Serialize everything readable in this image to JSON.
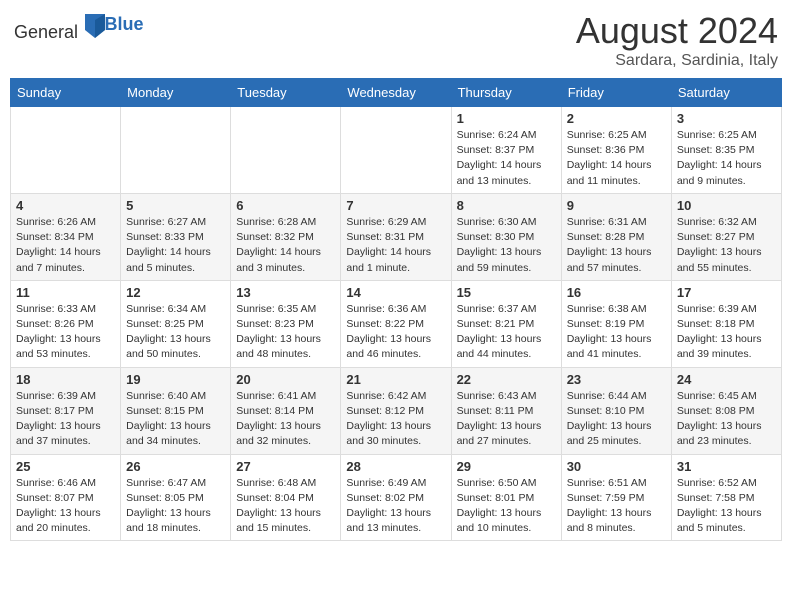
{
  "header": {
    "logo_general": "General",
    "logo_blue": "Blue",
    "month_year": "August 2024",
    "location": "Sardara, Sardinia, Italy"
  },
  "weekdays": [
    "Sunday",
    "Monday",
    "Tuesday",
    "Wednesday",
    "Thursday",
    "Friday",
    "Saturday"
  ],
  "weeks": [
    [
      {
        "day": "",
        "info": ""
      },
      {
        "day": "",
        "info": ""
      },
      {
        "day": "",
        "info": ""
      },
      {
        "day": "",
        "info": ""
      },
      {
        "day": "1",
        "info": "Sunrise: 6:24 AM\nSunset: 8:37 PM\nDaylight: 14 hours and 13 minutes."
      },
      {
        "day": "2",
        "info": "Sunrise: 6:25 AM\nSunset: 8:36 PM\nDaylight: 14 hours and 11 minutes."
      },
      {
        "day": "3",
        "info": "Sunrise: 6:25 AM\nSunset: 8:35 PM\nDaylight: 14 hours and 9 minutes."
      }
    ],
    [
      {
        "day": "4",
        "info": "Sunrise: 6:26 AM\nSunset: 8:34 PM\nDaylight: 14 hours and 7 minutes."
      },
      {
        "day": "5",
        "info": "Sunrise: 6:27 AM\nSunset: 8:33 PM\nDaylight: 14 hours and 5 minutes."
      },
      {
        "day": "6",
        "info": "Sunrise: 6:28 AM\nSunset: 8:32 PM\nDaylight: 14 hours and 3 minutes."
      },
      {
        "day": "7",
        "info": "Sunrise: 6:29 AM\nSunset: 8:31 PM\nDaylight: 14 hours and 1 minute."
      },
      {
        "day": "8",
        "info": "Sunrise: 6:30 AM\nSunset: 8:30 PM\nDaylight: 13 hours and 59 minutes."
      },
      {
        "day": "9",
        "info": "Sunrise: 6:31 AM\nSunset: 8:28 PM\nDaylight: 13 hours and 57 minutes."
      },
      {
        "day": "10",
        "info": "Sunrise: 6:32 AM\nSunset: 8:27 PM\nDaylight: 13 hours and 55 minutes."
      }
    ],
    [
      {
        "day": "11",
        "info": "Sunrise: 6:33 AM\nSunset: 8:26 PM\nDaylight: 13 hours and 53 minutes."
      },
      {
        "day": "12",
        "info": "Sunrise: 6:34 AM\nSunset: 8:25 PM\nDaylight: 13 hours and 50 minutes."
      },
      {
        "day": "13",
        "info": "Sunrise: 6:35 AM\nSunset: 8:23 PM\nDaylight: 13 hours and 48 minutes."
      },
      {
        "day": "14",
        "info": "Sunrise: 6:36 AM\nSunset: 8:22 PM\nDaylight: 13 hours and 46 minutes."
      },
      {
        "day": "15",
        "info": "Sunrise: 6:37 AM\nSunset: 8:21 PM\nDaylight: 13 hours and 44 minutes."
      },
      {
        "day": "16",
        "info": "Sunrise: 6:38 AM\nSunset: 8:19 PM\nDaylight: 13 hours and 41 minutes."
      },
      {
        "day": "17",
        "info": "Sunrise: 6:39 AM\nSunset: 8:18 PM\nDaylight: 13 hours and 39 minutes."
      }
    ],
    [
      {
        "day": "18",
        "info": "Sunrise: 6:39 AM\nSunset: 8:17 PM\nDaylight: 13 hours and 37 minutes."
      },
      {
        "day": "19",
        "info": "Sunrise: 6:40 AM\nSunset: 8:15 PM\nDaylight: 13 hours and 34 minutes."
      },
      {
        "day": "20",
        "info": "Sunrise: 6:41 AM\nSunset: 8:14 PM\nDaylight: 13 hours and 32 minutes."
      },
      {
        "day": "21",
        "info": "Sunrise: 6:42 AM\nSunset: 8:12 PM\nDaylight: 13 hours and 30 minutes."
      },
      {
        "day": "22",
        "info": "Sunrise: 6:43 AM\nSunset: 8:11 PM\nDaylight: 13 hours and 27 minutes."
      },
      {
        "day": "23",
        "info": "Sunrise: 6:44 AM\nSunset: 8:10 PM\nDaylight: 13 hours and 25 minutes."
      },
      {
        "day": "24",
        "info": "Sunrise: 6:45 AM\nSunset: 8:08 PM\nDaylight: 13 hours and 23 minutes."
      }
    ],
    [
      {
        "day": "25",
        "info": "Sunrise: 6:46 AM\nSunset: 8:07 PM\nDaylight: 13 hours and 20 minutes."
      },
      {
        "day": "26",
        "info": "Sunrise: 6:47 AM\nSunset: 8:05 PM\nDaylight: 13 hours and 18 minutes."
      },
      {
        "day": "27",
        "info": "Sunrise: 6:48 AM\nSunset: 8:04 PM\nDaylight: 13 hours and 15 minutes."
      },
      {
        "day": "28",
        "info": "Sunrise: 6:49 AM\nSunset: 8:02 PM\nDaylight: 13 hours and 13 minutes."
      },
      {
        "day": "29",
        "info": "Sunrise: 6:50 AM\nSunset: 8:01 PM\nDaylight: 13 hours and 10 minutes."
      },
      {
        "day": "30",
        "info": "Sunrise: 6:51 AM\nSunset: 7:59 PM\nDaylight: 13 hours and 8 minutes."
      },
      {
        "day": "31",
        "info": "Sunrise: 6:52 AM\nSunset: 7:58 PM\nDaylight: 13 hours and 5 minutes."
      }
    ]
  ]
}
